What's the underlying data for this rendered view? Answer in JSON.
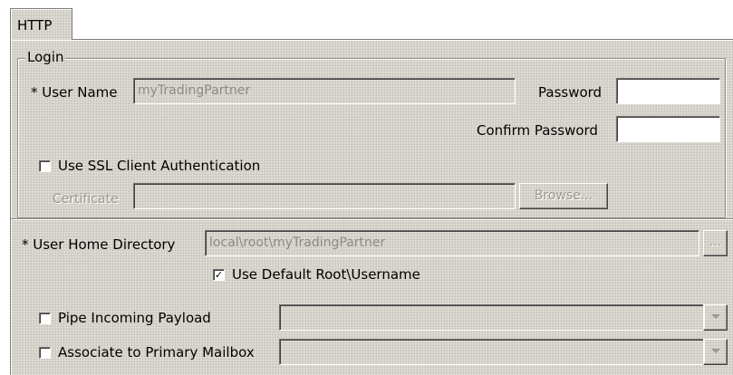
{
  "tab": {
    "label": "HTTP"
  },
  "login": {
    "legend": "Login",
    "user_name_label": "* User Name",
    "user_name_value": "myTradingPartner",
    "password_label": "Password",
    "password_value": "",
    "confirm_password_label": "Confirm Password",
    "confirm_password_value": "",
    "use_ssl_label": "Use SSL Client Authentication",
    "use_ssl_checked": false,
    "certificate_label": "Certificate",
    "certificate_value": "",
    "browse_label": "Browse..."
  },
  "home": {
    "label": "* User Home Directory",
    "value": "local\\root\\myTradingPartner",
    "ellipsis_label": "...",
    "use_default_label": "Use Default Root\\Username",
    "use_default_checked": true
  },
  "pipe": {
    "label": "Pipe Incoming Payload",
    "checked": false,
    "value": ""
  },
  "mailbox": {
    "label": "Associate to Primary Mailbox",
    "checked": false,
    "value": ""
  },
  "icons": {
    "check": "check-mark",
    "dropdown": "chevron-down"
  }
}
